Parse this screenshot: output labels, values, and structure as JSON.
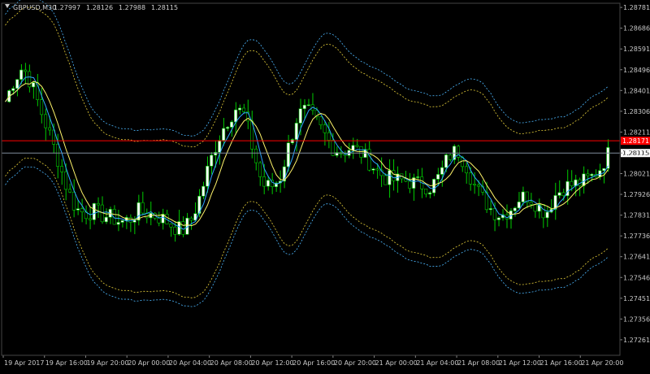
{
  "header": {
    "symbol_label": "GBPUSD,M30",
    "ohlc_values": [
      "1.27997",
      "1.28126",
      "1.27988",
      "1.28115"
    ]
  },
  "colors": {
    "background": "#000000",
    "bull_candle": "#ffffff",
    "bear_candle": "#000000",
    "wick": "#00cc00",
    "price_line_red": "#ff0000",
    "bid_line": "#7f8c9c",
    "ma_fast": "#2ea6ff",
    "ma_slow": "#fdf36a",
    "band_blue": "#4db8ff",
    "band_yellow": "#e6cf3a",
    "axis_text": "#c8c8c8"
  },
  "chart_data": {
    "type": "candlestick",
    "symbol": "GBPUSD",
    "timeframe": "M30",
    "ylim": [
      1.2719,
      1.288
    ],
    "y_ticks": [
      "1.28781",
      "1.28686",
      "1.28591",
      "1.28496",
      "1.28401",
      "1.28306",
      "1.28211",
      "1.28115",
      "1.28021",
      "1.27926",
      "1.27831",
      "1.27736",
      "1.27641",
      "1.27546",
      "1.27451",
      "1.27356",
      "1.27261"
    ],
    "x_ticks": [
      "19 Apr 2017",
      "19 Apr 16:00",
      "19 Apr 20:00",
      "20 Apr 00:00",
      "20 Apr 04:00",
      "20 Apr 08:00",
      "20 Apr 12:00",
      "20 Apr 16:00",
      "20 Apr 20:00",
      "21 Apr 00:00",
      "21 Apr 04:00",
      "21 Apr 08:00",
      "21 Apr 12:00",
      "21 Apr 16:00",
      "21 Apr 20:00"
    ],
    "price_levels": [
      {
        "label": "1.28171",
        "value": 1.28171,
        "style": "red"
      },
      {
        "label": "1.28115",
        "value": 1.28115,
        "style": "bid"
      }
    ],
    "close_path": [
      1.2835,
      1.2845,
      1.2851,
      1.2843,
      1.2831,
      1.282,
      1.2808,
      1.2795,
      1.2786,
      1.2784,
      1.2785,
      1.2783,
      1.2782,
      1.278,
      1.2781,
      1.2785,
      1.2784,
      1.2783,
      1.2781,
      1.2778,
      1.2776,
      1.2781,
      1.2792,
      1.2806,
      1.2818,
      1.2826,
      1.2832,
      1.2829,
      1.2812,
      1.2797,
      1.2796,
      1.28,
      1.2815,
      1.2829,
      1.2831,
      1.2826,
      1.282,
      1.2814,
      1.2812,
      1.2814,
      1.2812,
      1.2808,
      1.2803,
      1.28,
      1.2799,
      1.2799,
      1.2798,
      1.2797,
      1.2796,
      1.2801,
      1.281,
      1.2813,
      1.2806,
      1.2796,
      1.279,
      1.2785,
      1.2783,
      1.2786,
      1.2791,
      1.2792,
      1.2788,
      1.2784,
      1.2792,
      1.2796,
      1.2797,
      1.2798,
      1.28,
      1.2804,
      1.2811
    ],
    "envelope_offsets_inner": [
      0.0035,
      0.0034
    ],
    "envelope_offsets_outer": [
      0.004,
      0.0038
    ]
  }
}
